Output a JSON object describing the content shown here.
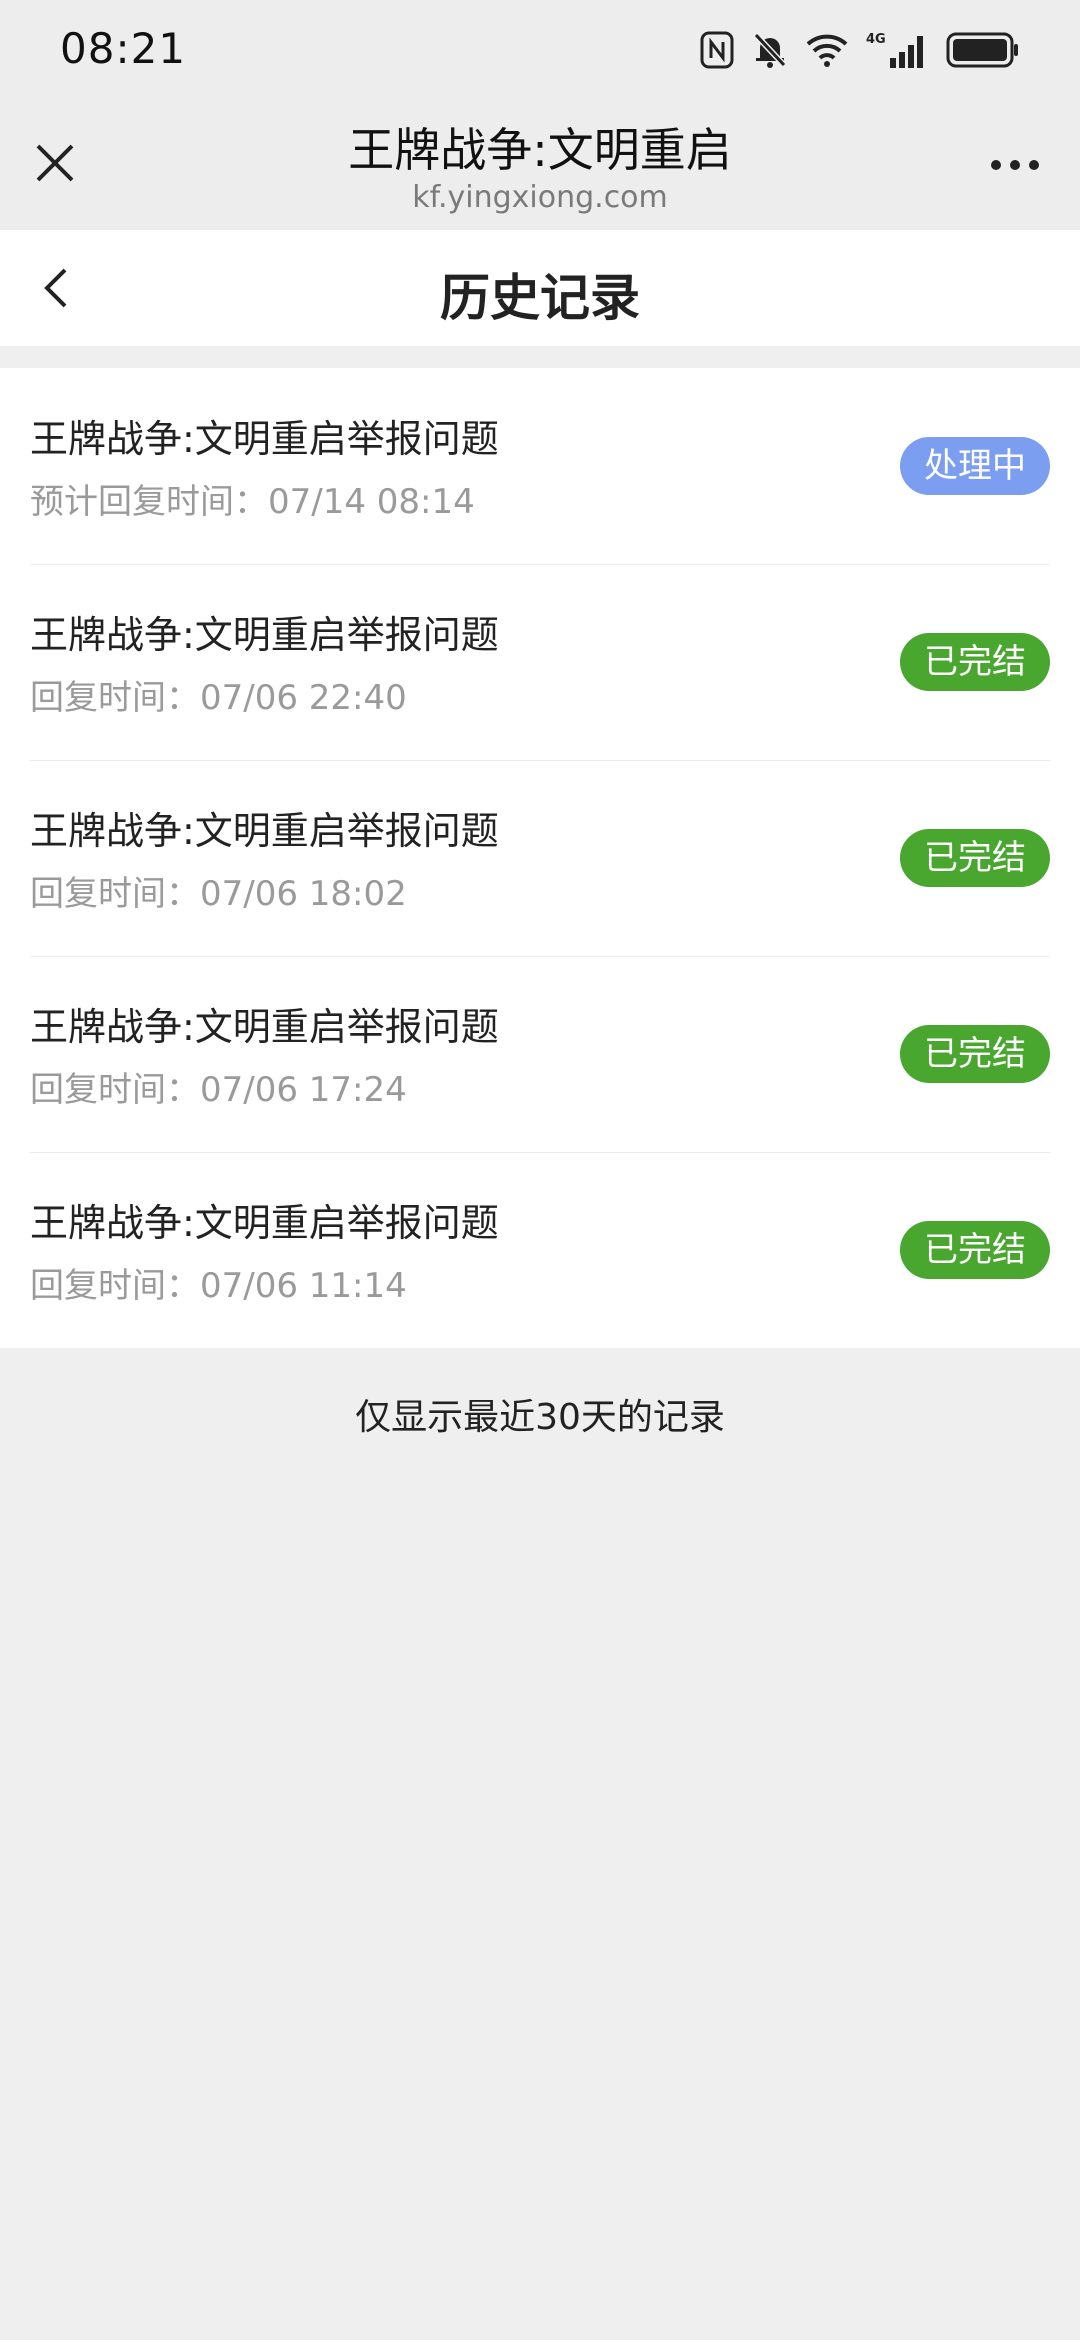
{
  "status_bar": {
    "time": "08:21",
    "icons": [
      "nfc-icon",
      "mute-icon",
      "wifi-icon",
      "signal-4g-icon",
      "battery-icon"
    ],
    "network_label": "4G"
  },
  "web_header": {
    "title": "王牌战争:文明重启",
    "url": "kf.yingxiong.com"
  },
  "nav": {
    "title": "历史记录"
  },
  "records": [
    {
      "title": "王牌战争:文明重启举报问题",
      "sub": "预计回复时间：07/14 08:14",
      "status": "处理中",
      "status_color": "#7b9ef0"
    },
    {
      "title": "王牌战争:文明重启举报问题",
      "sub": "回复时间：07/06 22:40",
      "status": "已完结",
      "status_color": "#49a62f"
    },
    {
      "title": "王牌战争:文明重启举报问题",
      "sub": "回复时间：07/06 18:02",
      "status": "已完结",
      "status_color": "#49a62f"
    },
    {
      "title": "王牌战争:文明重启举报问题",
      "sub": "回复时间：07/06 17:24",
      "status": "已完结",
      "status_color": "#49a62f"
    },
    {
      "title": "王牌战争:文明重启举报问题",
      "sub": "回复时间：07/06 11:14",
      "status": "已完结",
      "status_color": "#49a62f"
    }
  ],
  "footer_note": "仅显示最近30天的记录"
}
